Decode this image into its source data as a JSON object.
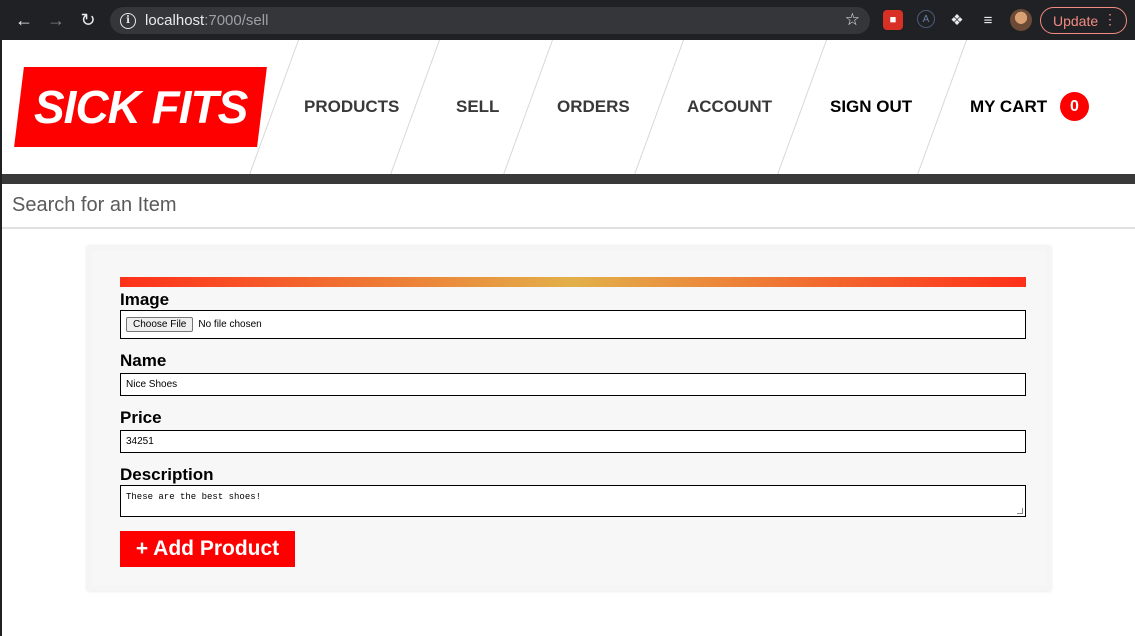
{
  "browser": {
    "url_host": "localhost",
    "url_path": ":7000/sell",
    "update_label": "Update"
  },
  "header": {
    "logo": "Sick Fits",
    "nav": [
      "Products",
      "Sell",
      "Orders",
      "Account",
      "Sign Out",
      "My Cart"
    ],
    "cart_count": "0"
  },
  "search": {
    "placeholder": "Search for an Item"
  },
  "form": {
    "image_label": "Image",
    "file_button": "Choose File",
    "file_status": "No file chosen",
    "name_label": "Name",
    "name_value": "Nice Shoes",
    "price_label": "Price",
    "price_value": "34251",
    "description_label": "Description",
    "description_value": "These are the best shoes!",
    "submit_label": "+ Add Product"
  },
  "colors": {
    "brand_red": "#ff0000",
    "dark_bar": "#393939"
  }
}
